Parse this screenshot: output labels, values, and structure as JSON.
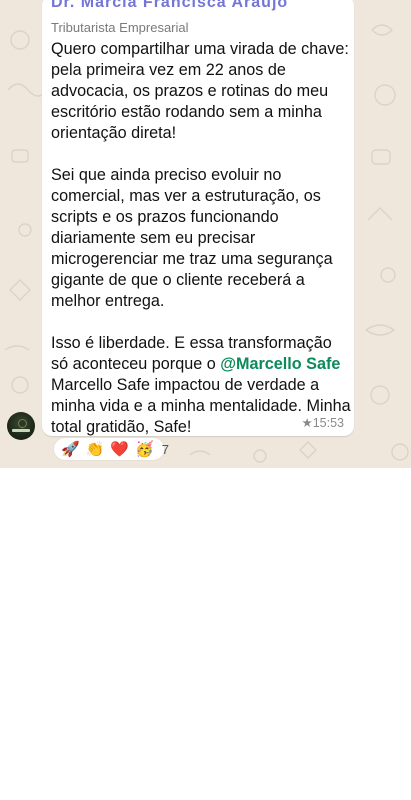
{
  "message": {
    "sender_name": "Dr. Marcia Francisca Araujo",
    "sender_role": "Tributarista Empresarial",
    "paragraphs": [
      "Quero compartilhar uma virada de chave: pela primeira vez em 22 anos de advocacia, os prazos e rotinas do meu escritório estão rodando sem a minha orientação direta!",
      "Sei que ainda preciso evoluir no comercial, mas ver a estruturação, os scripts e os prazos funcionando diariamente sem eu precisar microgerenciar me traz uma segurança gigante de que o cliente receberá a melhor entrega."
    ],
    "last_paragraph": {
      "before_mention": "Isso é liberdade. E essa transformação só aconteceu porque o ",
      "mention": "@Marcello Safe",
      "after_mention": " Marcello Safe impactou de verdade a minha vida e a minha mentalidade. Minha total gratidão, Safe!"
    },
    "starred_icon": "★",
    "time": "15:53"
  },
  "reactions": {
    "emojis": [
      "🚀",
      "👏",
      "❤️",
      "🥳"
    ],
    "count": "7"
  },
  "colors": {
    "wallpaper": "#efe7dc",
    "bubble": "#ffffff",
    "mention": "#0b8a5b",
    "sender_name": "#5b5fcf"
  }
}
